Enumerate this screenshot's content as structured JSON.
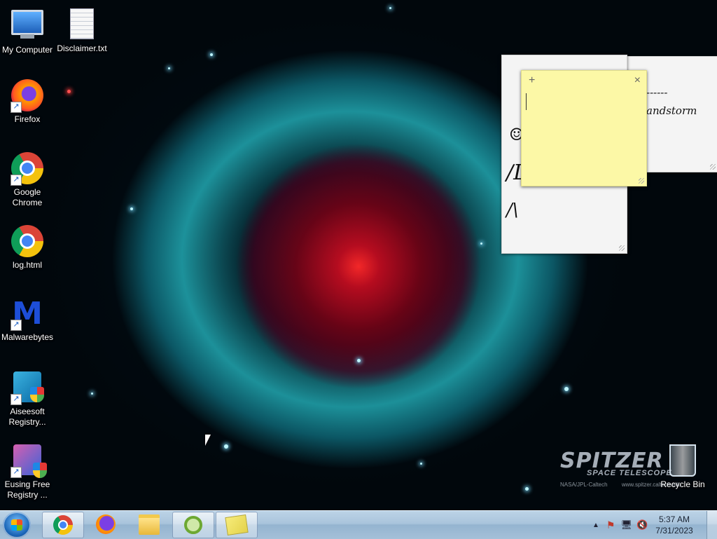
{
  "desktop": {
    "icons": [
      {
        "label": "My Computer"
      },
      {
        "label": "Disclaimer.txt"
      },
      {
        "label": "Firefox"
      },
      {
        "label": "Google Chrome"
      },
      {
        "label": "log.html"
      },
      {
        "label": "Malwarebytes"
      },
      {
        "label": "Aiseesoft Registry..."
      },
      {
        "label": "Eusing Free Registry ..."
      },
      {
        "label": "Recycle Bin"
      }
    ],
    "wallpaper_logo": {
      "title": "SPITZER",
      "subtitle": "SPACE TELESCOPE",
      "credit": "NASA/JPL-Caltech",
      "url": "www.spitzer.caltech.edu"
    }
  },
  "sticky_notes": {
    "back_note_text": "------\nandstorm",
    "middle_note_glyphs": [
      "☺",
      "/L",
      "/\\"
    ],
    "front_note": {
      "add_label": "+",
      "close_label": "×",
      "text": ""
    }
  },
  "taskbar": {
    "pinned": [
      {
        "name": "Google Chrome"
      },
      {
        "name": "Firefox"
      },
      {
        "name": "Windows Explorer"
      },
      {
        "name": "Registry tool"
      },
      {
        "name": "Sticky Notes",
        "active": true
      }
    ],
    "tray": {
      "overflow": "▲",
      "flag": "⚑",
      "network": "🖥",
      "volume": "🔇"
    },
    "clock": {
      "time": "5:37 AM",
      "date": "7/31/2023"
    }
  },
  "colors": {
    "taskbar": "#a9c4dc",
    "sticky_yellow": "#fcf8a6",
    "sticky_white": "#f4f4f4"
  }
}
